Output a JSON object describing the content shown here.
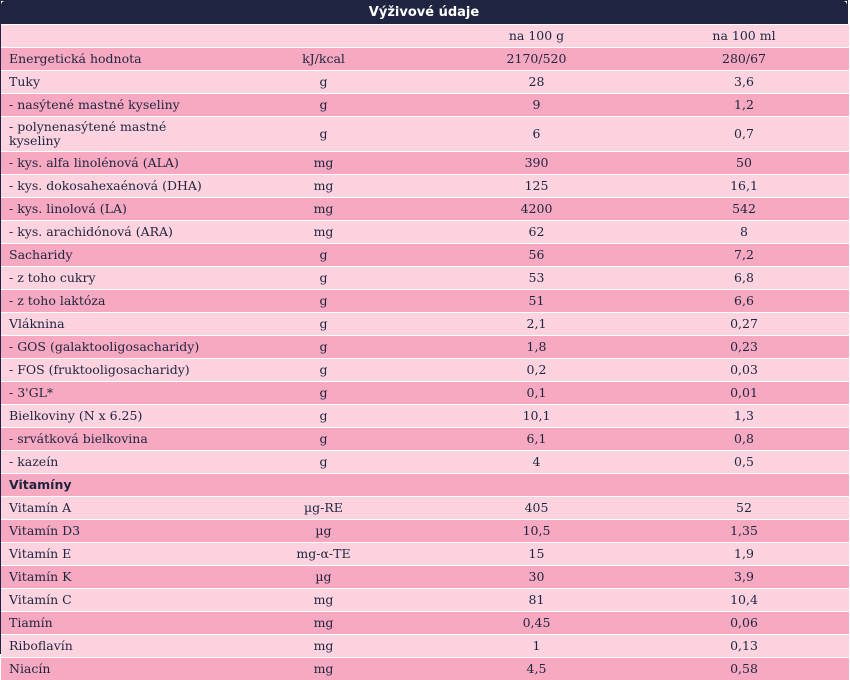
{
  "title": "Výživové údaje",
  "header": {
    "col1": "",
    "col2": "",
    "col3": "na 100 g",
    "col4": "na 100 ml"
  },
  "rows": [
    {
      "name": "Energetická hodnota",
      "unit": "kJ/kcal",
      "per100g": "2170/520",
      "per100ml": "280/67"
    },
    {
      "name": "Tuky",
      "unit": "g",
      "per100g": "28",
      "per100ml": "3,6"
    },
    {
      "name": "- nasýtené mastné kyseliny",
      "unit": "g",
      "per100g": "9",
      "per100ml": "1,2"
    },
    {
      "name": "- polynenasýtené mastné kyseliny",
      "unit": "g",
      "per100g": "6",
      "per100ml": "0,7"
    },
    {
      "name": "- kys. alfa linolénová (ALA)",
      "unit": "mg",
      "per100g": "390",
      "per100ml": "50"
    },
    {
      "name": "- kys. dokosahexaénová (DHA)",
      "unit": "mg",
      "per100g": "125",
      "per100ml": "16,1"
    },
    {
      "name": "- kys. linolová (LA)",
      "unit": "mg",
      "per100g": "4200",
      "per100ml": "542"
    },
    {
      "name": "- kys. arachidónová (ARA)",
      "unit": "mg",
      "per100g": "62",
      "per100ml": "8"
    },
    {
      "name": "Sacharidy",
      "unit": "g",
      "per100g": "56",
      "per100ml": "7,2"
    },
    {
      "name": "- z toho cukry",
      "unit": "g",
      "per100g": "53",
      "per100ml": "6,8"
    },
    {
      "name": "- z toho laktóza",
      "unit": "g",
      "per100g": "51",
      "per100ml": "6,6"
    },
    {
      "name": "Vláknina",
      "unit": "g",
      "per100g": "2,1",
      "per100ml": "0,27"
    },
    {
      "name": "- GOS (galaktooligosacharidy)",
      "unit": "g",
      "per100g": "1,8",
      "per100ml": "0,23"
    },
    {
      "name": "- FOS (fruktooligosacharidy)",
      "unit": "g",
      "per100g": "0,2",
      "per100ml": "0,03"
    },
    {
      "name": "- 3'GL*",
      "unit": "g",
      "per100g": "0,1",
      "per100ml": "0,01"
    },
    {
      "name": "Bielkoviny (N x 6.25)",
      "unit": "g",
      "per100g": "10,1",
      "per100ml": "1,3"
    },
    {
      "name": "- srvátková bielkovina",
      "unit": "g",
      "per100g": "6,1",
      "per100ml": "0,8"
    },
    {
      "name": "- kazeín",
      "unit": "g",
      "per100g": "4",
      "per100ml": "0,5"
    },
    {
      "name": "Vitamíny",
      "unit": "",
      "per100g": "",
      "per100ml": ""
    },
    {
      "name": "Vitamín A",
      "unit": "µg-RE",
      "per100g": "405",
      "per100ml": "52"
    },
    {
      "name": "Vitamín D3",
      "unit": "µg",
      "per100g": "10,5",
      "per100ml": "1,35"
    },
    {
      "name": "Vitamín E",
      "unit": "mg-α-TE",
      "per100g": "15",
      "per100ml": "1,9"
    },
    {
      "name": "Vitamín K",
      "unit": "µg",
      "per100g": "30",
      "per100ml": "3,9"
    },
    {
      "name": "Vitamín C",
      "unit": "mg",
      "per100g": "81",
      "per100ml": "10,4"
    },
    {
      "name": "Tiamín",
      "unit": "mg",
      "per100g": "0,45",
      "per100ml": "0,06"
    },
    {
      "name": "Riboflavín",
      "unit": "mg",
      "per100g": "1",
      "per100ml": "0,13"
    },
    {
      "name": "Niacín",
      "unit": "mg",
      "per100g": "4,5",
      "per100ml": "0,58"
    }
  ],
  "colors": {
    "header_bg": "#1f2540",
    "row_light": "#fcd3df",
    "row_dark": "#f6a9c0"
  }
}
